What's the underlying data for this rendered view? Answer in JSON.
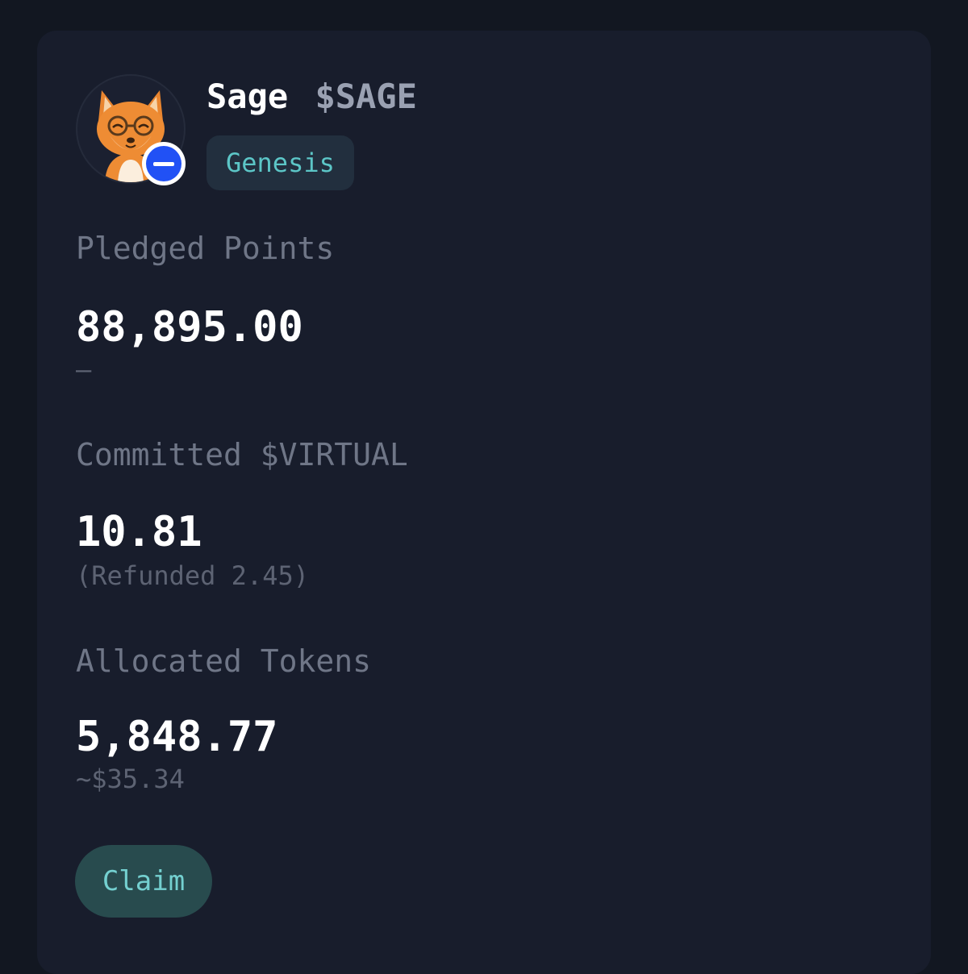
{
  "project": {
    "name": "Sage",
    "ticker": "$SAGE",
    "tag": "Genesis",
    "avatar_icon": "fox-with-glasses-avatar",
    "chain_icon": "base-chain-icon"
  },
  "pledged": {
    "label": "Pledged Points",
    "value": "88,895.00",
    "sub": "–"
  },
  "committed": {
    "label": "Committed $VIRTUAL",
    "value": "10.81",
    "sub": "(Refunded 2.45)"
  },
  "allocated": {
    "label": "Allocated Tokens",
    "value": "5,848.77",
    "sub": "~$35.34"
  },
  "actions": {
    "claim_label": "Claim"
  },
  "colors": {
    "page_bg": "#121721",
    "card_bg": "#181d2c",
    "accent_teal": "#5cc6c7",
    "claim_bg": "#284b4e",
    "chain_blue": "#2151f5"
  }
}
